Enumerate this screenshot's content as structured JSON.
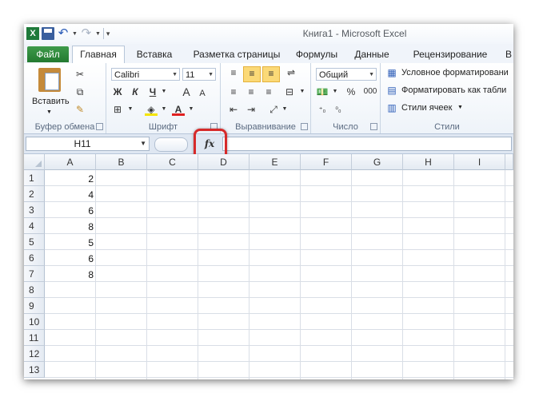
{
  "window": {
    "title": "Книга1  -  Microsoft Excel"
  },
  "qat": {
    "icons": [
      "excel-logo-icon",
      "save-icon",
      "undo-icon",
      "redo-icon"
    ]
  },
  "tabs": [
    {
      "label": "Файл"
    },
    {
      "label": "Главная"
    },
    {
      "label": "Вставка"
    },
    {
      "label": "Разметка страницы"
    },
    {
      "label": "Формулы"
    },
    {
      "label": "Данные"
    },
    {
      "label": "Рецензирование"
    },
    {
      "label": "В"
    }
  ],
  "ribbon": {
    "clipboard": {
      "paste_label": "Вставить",
      "group_label": "Буфер обмена"
    },
    "font": {
      "family": "Calibri",
      "size": "11",
      "bold": "Ж",
      "italic": "К",
      "underline": "Ч",
      "grow": "A",
      "shrink": "A",
      "group_label": "Шрифт"
    },
    "alignment": {
      "group_label": "Выравнивание"
    },
    "number": {
      "format": "Общий",
      "percent": "%",
      "thousands": "000",
      "group_label": "Число"
    },
    "styles": {
      "conditional": "Условное форматировани",
      "table": "Форматировать как табли",
      "cell_styles": "Стили ячеек",
      "group_label": "Стили"
    }
  },
  "formula_bar": {
    "name_box": "H11",
    "fx_label": "fx",
    "formula": ""
  },
  "grid": {
    "columns": [
      "A",
      "B",
      "C",
      "D",
      "E",
      "F",
      "G",
      "H",
      "I"
    ],
    "rows": [
      "1",
      "2",
      "3",
      "4",
      "5",
      "6",
      "7",
      "8",
      "9",
      "10",
      "11",
      "12",
      "13"
    ],
    "column_a_values": [
      "2",
      "4",
      "6",
      "8",
      "5",
      "6",
      "8"
    ]
  },
  "colors": {
    "file_tab": "#2f8a3c",
    "highlight": "#d62a2a",
    "selected_align": "#fbd977"
  }
}
